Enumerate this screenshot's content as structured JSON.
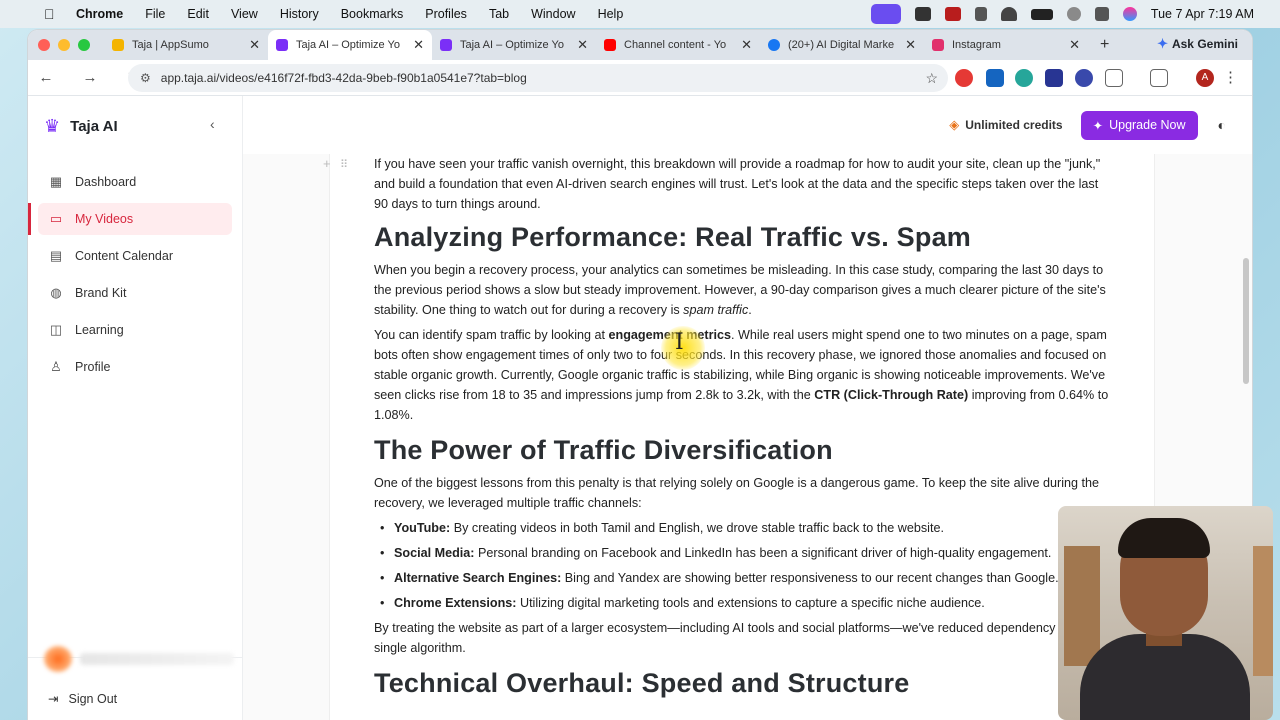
{
  "menubar": {
    "app_name": "Chrome",
    "menus": [
      "File",
      "Edit",
      "View",
      "History",
      "Bookmarks",
      "Profiles",
      "Tab",
      "Window",
      "Help"
    ],
    "clock": "Tue 7 Apr  7:19 AM"
  },
  "tabs": [
    {
      "title": "Taja | AppSumo",
      "color": "#f4b400",
      "active": false
    },
    {
      "title": "Taja AI – Optimize Yo",
      "color": "#7b2ff7",
      "active": true
    },
    {
      "title": "Taja AI – Optimize Yo",
      "color": "#7b2ff7",
      "active": false
    },
    {
      "title": "Channel content - Yo",
      "color": "#ff0000",
      "active": false
    },
    {
      "title": "(20+) AI Digital Marke",
      "color": "#1877f2",
      "active": false
    },
    {
      "title": "Instagram",
      "color": "#e1306c",
      "active": false
    }
  ],
  "browser": {
    "ask_gemini": "Ask Gemini",
    "url": "app.taja.ai/videos/e416f72f-fbd3-42da-9beb-f90b1a0541e7?tab=blog",
    "profile_initial": "A"
  },
  "sidebar": {
    "brand": "Taja AI",
    "items": [
      {
        "label": "Dashboard",
        "icon": "dashboard-icon",
        "active": false
      },
      {
        "label": "My Videos",
        "icon": "video-icon",
        "active": true
      },
      {
        "label": "Content Calendar",
        "icon": "calendar-icon",
        "active": false
      },
      {
        "label": "Brand Kit",
        "icon": "palette-icon",
        "active": false
      },
      {
        "label": "Learning",
        "icon": "book-icon",
        "active": false
      },
      {
        "label": "Profile",
        "icon": "user-icon",
        "active": false
      }
    ],
    "sign_out": "Sign Out"
  },
  "topbar": {
    "credits_label": "Unlimited credits",
    "upgrade_label": "Upgrade Now"
  },
  "article": {
    "intro": "If you have seen your traffic vanish overnight, this breakdown will provide a roadmap for how to audit your site, clean up the \"junk,\" and build a foundation that even AI-driven search engines will trust. Let's look at the data and the specific steps taken over the last 90 days to turn things around.",
    "h_performance": "Analyzing Performance: Real Traffic vs. Spam",
    "p_perf1_a": "When you begin a recovery process, your analytics can sometimes be misleading. In this case study, comparing the last 30 days to the previous period shows a slow but steady improvement. However, a 90-day comparison gives a much clearer picture of the site's stability. One thing to watch out for during a recovery is ",
    "p_perf1_em": "spam traffic",
    "p_perf1_end": ".",
    "p_perf2_a": "You can identify spam traffic by looking at ",
    "p_perf2_b1": "engagement metrics",
    "p_perf2_c": ". While real users might spend one to two minutes on a page, spam bots often show engagement times of only two to four seconds. In this recovery phase, we ignored those anomalies and focused on stable organic growth. Currently, Google organic traffic is stabilizing, while Bing organic is showing noticeable improvements. We've seen clicks rise from 18 to 35 and impressions jump from 2.8k to 3.2k, with the ",
    "p_perf2_b2": "CTR (Click-Through Rate)",
    "p_perf2_d": " improving from 0.64% to 1.08%.",
    "h_diversification": "The Power of Traffic Diversification",
    "p_div": "One of the biggest lessons from this penalty is that relying solely on Google is a dangerous game. To keep the site alive during the recovery, we leveraged multiple traffic channels:",
    "bullets": [
      {
        "bold": "YouTube:",
        "text": " By creating videos in both Tamil and English, we drove stable traffic back to the website."
      },
      {
        "bold": "Social Media:",
        "text": " Personal branding on Facebook and LinkedIn has been a significant driver of high-quality engagement."
      },
      {
        "bold": "Alternative Search Engines:",
        "text": " Bing and Yandex are showing better responsiveness to our recent changes than Google."
      },
      {
        "bold": "Chrome Extensions:",
        "text": " Utilizing digital marketing tools and extensions to capture a specific niche audience."
      }
    ],
    "p_ecosystem": "By treating the website as part of a larger ecosystem—including AI tools and social platforms—we've reduced dependency on any single algorithm.",
    "h_technical": "Technical Overhaul: Speed and Structure"
  }
}
